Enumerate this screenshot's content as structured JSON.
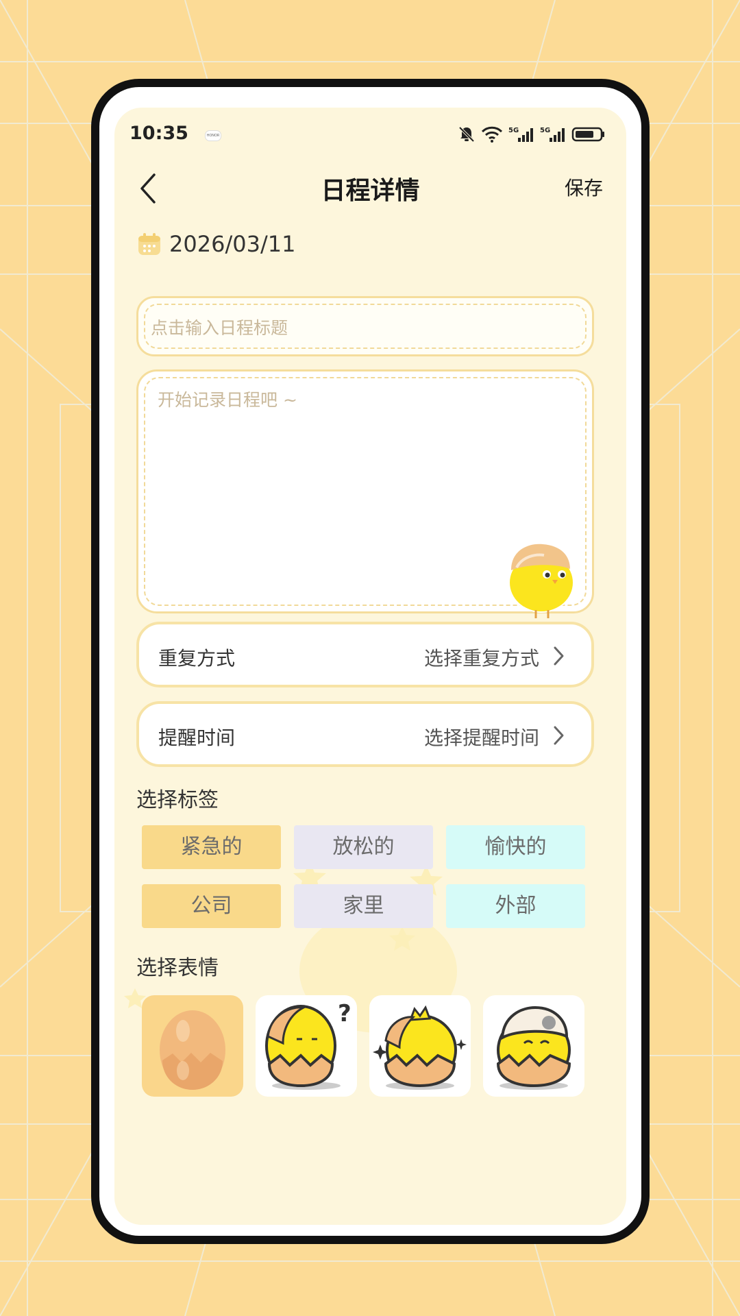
{
  "status_bar": {
    "time": "10:35",
    "brand_badge": "HONOR",
    "icons": [
      "bell-muted-icon",
      "wifi-icon",
      "signal-5g-icon",
      "signal-5g-icon",
      "battery-icon"
    ],
    "network_label": "5G"
  },
  "header": {
    "title": "日程详情",
    "save_label": "保存",
    "back_icon": "chevron-left-icon"
  },
  "date": {
    "icon": "calendar-icon",
    "value": "2026/03/11"
  },
  "title_input": {
    "placeholder": "点击输入日程标题",
    "value": ""
  },
  "description_input": {
    "placeholder": "开始记录日程吧 ~",
    "value": ""
  },
  "options": [
    {
      "label": "重复方式",
      "value": "选择重复方式"
    },
    {
      "label": "提醒时间",
      "value": "选择提醒时间"
    }
  ],
  "tags_section": {
    "title": "选择标签",
    "tags": [
      {
        "label": "紧急的",
        "bg": "#f9d98a",
        "color": "#6b6b6b"
      },
      {
        "label": "放松的",
        "bg": "#e9e7f2",
        "color": "#6b6b6b"
      },
      {
        "label": "愉快的",
        "bg": "#d6fbf8",
        "color": "#6b6b6b"
      },
      {
        "label": "公司",
        "bg": "#f9d98a",
        "color": "#6b6b6b"
      },
      {
        "label": "家里",
        "bg": "#e9e7f2",
        "color": "#6b6b6b"
      },
      {
        "label": "外部",
        "bg": "#d6fbf8",
        "color": "#6b6b6b"
      }
    ]
  },
  "emoji_section": {
    "title": "选择表情",
    "emojis": [
      {
        "name": "egg-plain-icon",
        "selected": true
      },
      {
        "name": "chick-question-icon",
        "selected": false
      },
      {
        "name": "chick-sparkle-icon",
        "selected": false
      },
      {
        "name": "chick-shell-hat-icon",
        "selected": false
      }
    ]
  },
  "colors": {
    "background": "#fcdb96",
    "screen": "#fdf6dc",
    "border_accent": "#f5dd9c"
  }
}
